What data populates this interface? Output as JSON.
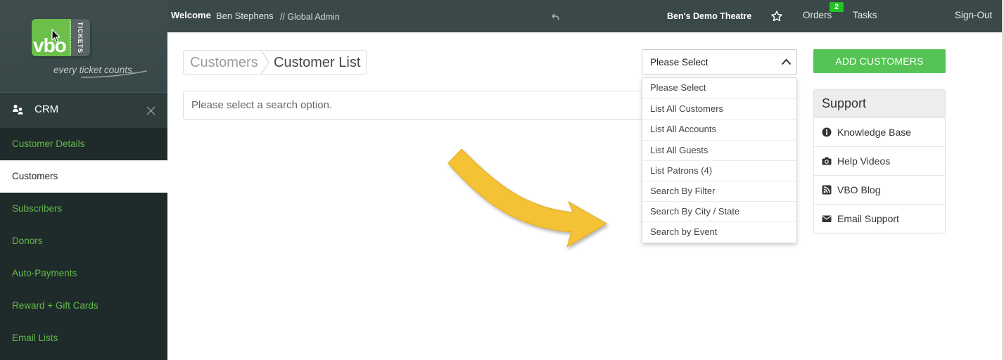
{
  "brand": {
    "logo_text": "vbo",
    "logo_sub": "TICKETS",
    "tagline": "every ticket counts."
  },
  "colors": {
    "sidebar_bg": "#1f2a2a",
    "topbar_bg": "#3a4848",
    "sidebar_link": "#62bc4a",
    "logo_green": "#6cc04a",
    "accent_green": "#55c455",
    "badge_green": "#22c322",
    "annotation_arrow": "#f5c234"
  },
  "sidebar": {
    "section_title": "CRM",
    "section_icon": "users-icon",
    "items": [
      {
        "label": "Customer Details",
        "active": false
      },
      {
        "label": "Customers",
        "active": true
      },
      {
        "label": "Subscribers",
        "active": false
      },
      {
        "label": "Donors",
        "active": false
      },
      {
        "label": "Auto-Payments",
        "active": false
      },
      {
        "label": "Reward + Gift Cards",
        "active": false
      },
      {
        "label": "Email Lists",
        "active": false
      }
    ]
  },
  "topbar": {
    "welcome": "Welcome",
    "user_name": "Ben Stephens",
    "role": "// Global Admin",
    "venue": "Ben's Demo Theatre",
    "orders_label": "Orders",
    "orders_badge": "2",
    "tasks_label": "Tasks",
    "signout_label": "Sign-Out",
    "icons": [
      "reply-icon",
      "star-icon"
    ]
  },
  "breadcrumb": [
    {
      "label": "Customers"
    },
    {
      "label": "Customer List"
    }
  ],
  "search": {
    "placeholder": "Please select a search option."
  },
  "search_type_select": {
    "selected": "Please Select",
    "open": true,
    "options": [
      "Please Select",
      "List All Customers",
      "List All Accounts",
      "List All Guests",
      "List Patrons (4)",
      "Search By Filter",
      "Search By City / State",
      "Search by Event"
    ]
  },
  "add_button": {
    "label": "ADD CUSTOMERS"
  },
  "support": {
    "title": "Support",
    "items": [
      {
        "label": "Knowledge Base",
        "icon": "info-circle-icon"
      },
      {
        "label": "Help Videos",
        "icon": "camera-icon"
      },
      {
        "label": "VBO Blog",
        "icon": "rss-icon"
      },
      {
        "label": "Email Support",
        "icon": "envelope-icon"
      }
    ]
  }
}
